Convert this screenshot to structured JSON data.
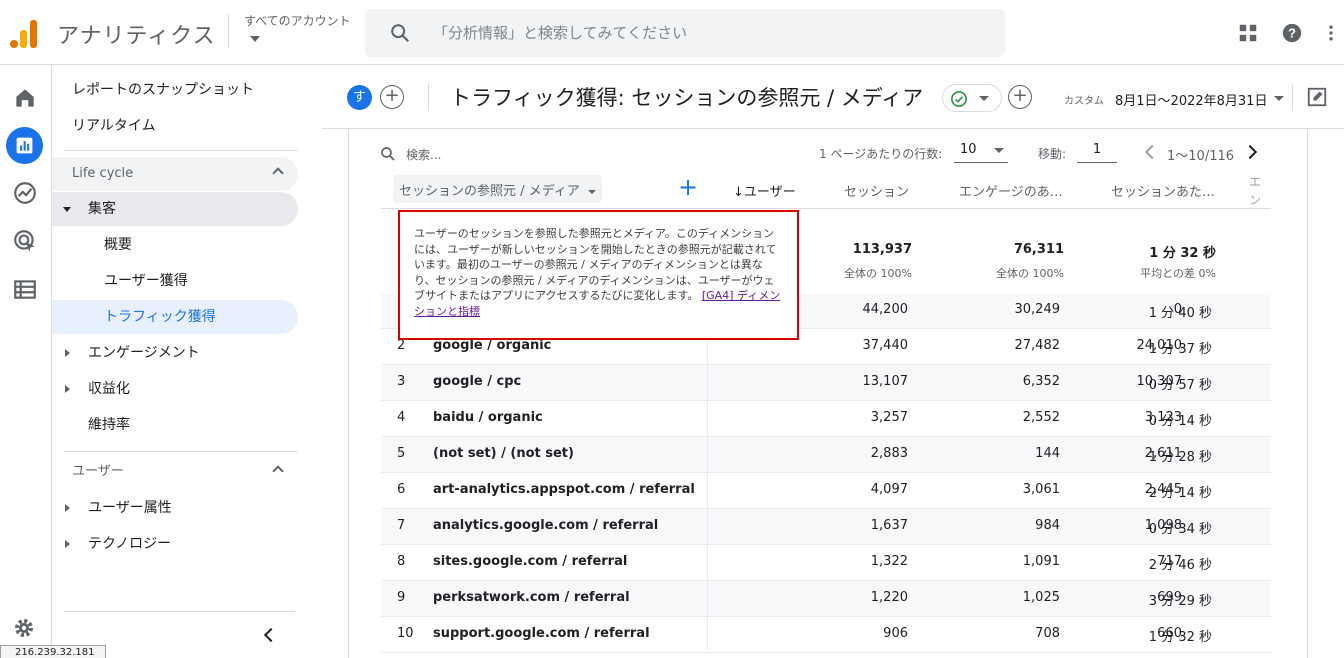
{
  "app": {
    "title": "アナリティクス",
    "account_label": "すべてのアカウント"
  },
  "search": {
    "placeholder": "「分析情報」と検索してみてください"
  },
  "colors": {
    "accent": "#1a73e8",
    "logo_orange": "#f9ab00",
    "logo_dark": "#e37400",
    "tooltip_border": "#d50000"
  },
  "nav": {
    "snapshot": "レポートのスナップショット",
    "realtime": "リアルタイム",
    "section_lifecycle": "Life cycle",
    "acquisition": "集客",
    "overview": "概要",
    "user_acq": "ユーザー獲得",
    "traffic_acq": "トラフィック獲得",
    "engagement": "エンゲージメント",
    "monetization": "収益化",
    "retention": "維持率",
    "section_user": "ユーザー",
    "demographics": "ユーザー属性",
    "technology": "テクノロジー"
  },
  "header": {
    "avatar_letter": "す",
    "title": "トラフィック獲得: セッションの参照元 / メディア",
    "date_label": "カスタム",
    "date_range": "8月1日～2022年8月31日"
  },
  "table": {
    "search_placeholder": "検索...",
    "rows_per_page_label": "1 ページあたりの行数:",
    "rows_per_page": "10",
    "goto_label": "移動:",
    "goto_value": "1",
    "page_range": "1～10/116",
    "dimension_chip": "セッションの参照元 / メディア",
    "columns": [
      "↓ユーザー",
      "セッション",
      "エンゲージのあ…",
      "セッションあた…",
      "エン ユー"
    ],
    "totals": {
      "sessions": "113,937",
      "sessions_sub": "全体の 100%",
      "engaged": "76,311",
      "engaged_sub": "全体の 100%",
      "avg": "1 分 32 秒",
      "avg_sub": "平均との差 0%"
    },
    "rows": [
      {
        "idx": "",
        "source": "",
        "users": "0",
        "sessions": "44,200",
        "engaged": "30,249",
        "avg": "1 分 40 秒"
      },
      {
        "idx": "2",
        "source": "google / organic",
        "users": "24,010",
        "sessions": "37,440",
        "engaged": "27,482",
        "avg": "1 分 37 秒"
      },
      {
        "idx": "3",
        "source": "google / cpc",
        "users": "10,307",
        "sessions": "13,107",
        "engaged": "6,352",
        "avg": "0 分 57 秒"
      },
      {
        "idx": "4",
        "source": "baidu / organic",
        "users": "3,123",
        "sessions": "3,257",
        "engaged": "2,552",
        "avg": "0 分 14 秒"
      },
      {
        "idx": "5",
        "source": "(not set) / (not set)",
        "users": "2,611",
        "sessions": "2,883",
        "engaged": "144",
        "avg": "1 分 28 秒"
      },
      {
        "idx": "6",
        "source": "art-analytics.appspot.com / referral",
        "users": "2,445",
        "sessions": "4,097",
        "engaged": "3,061",
        "avg": "2 分 14 秒"
      },
      {
        "idx": "7",
        "source": "analytics.google.com / referral",
        "users": "1,098",
        "sessions": "1,637",
        "engaged": "984",
        "avg": "0 分 34 秒"
      },
      {
        "idx": "8",
        "source": "sites.google.com / referral",
        "users": "717",
        "sessions": "1,322",
        "engaged": "1,091",
        "avg": "2 分 46 秒"
      },
      {
        "idx": "9",
        "source": "perksatwork.com / referral",
        "users": "699",
        "sessions": "1,220",
        "engaged": "1,025",
        "avg": "3 分 29 秒"
      },
      {
        "idx": "10",
        "source": "support.google.com / referral",
        "users": "660",
        "sessions": "906",
        "engaged": "708",
        "avg": "1 分 32 秒"
      }
    ]
  },
  "tooltip": {
    "text": "ユーザーのセッションを参照した参照元とメディア。このディメンションには、ユーザーが新しいセッションを開始したときの参照元が記載されています。最初のユーザーの参照元 / メディアのディメンションとは異なり、セッションの参照元 / メディアのディメンションは、ユーザーがウェブサイトまたはアプリにアクセスするたびに変化します。",
    "link": "[GA4] ディメンションと指標"
  },
  "footer": {
    "ip": "216.239.32.181"
  }
}
